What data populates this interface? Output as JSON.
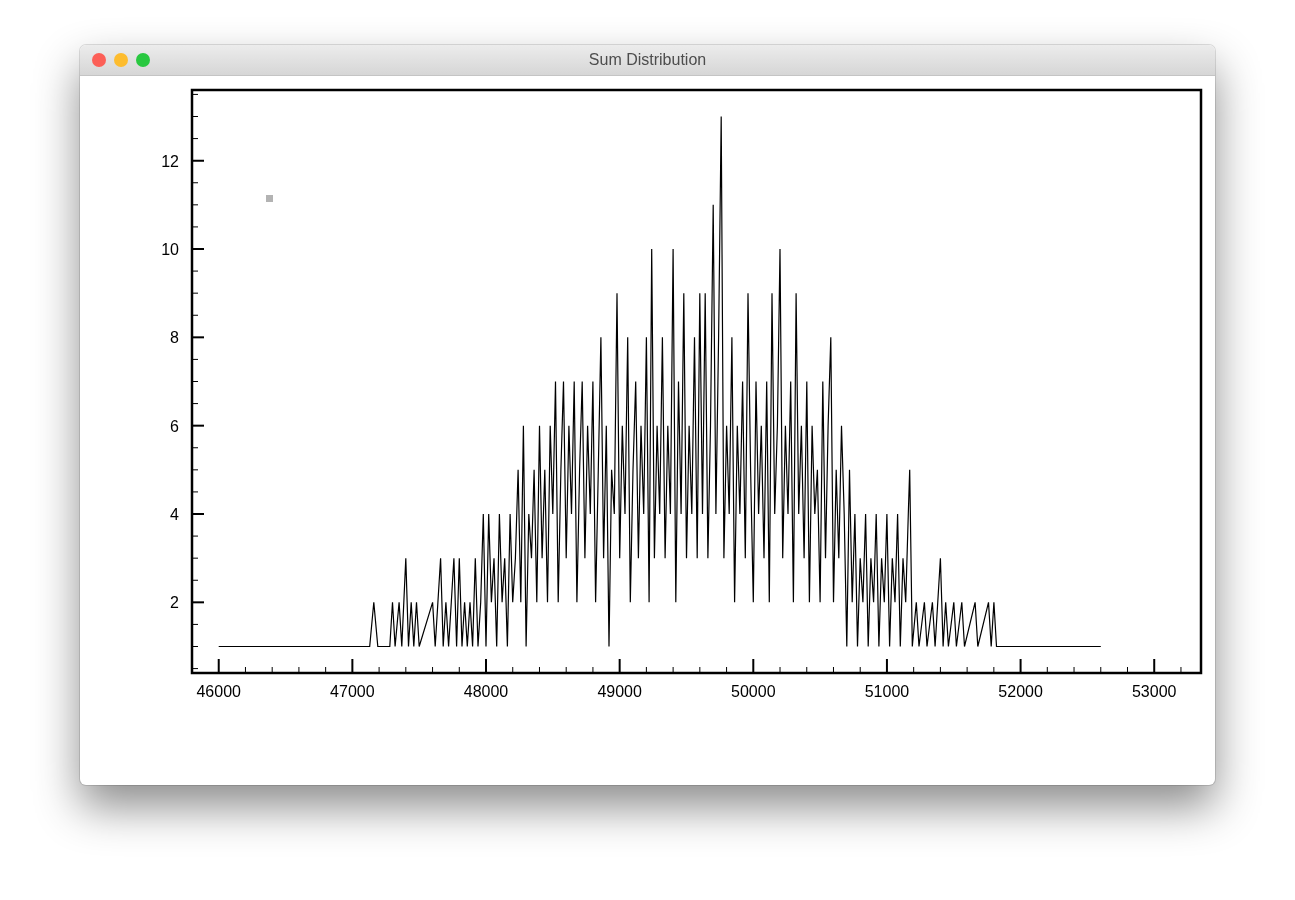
{
  "window": {
    "title": "Sum Distribution"
  },
  "chart": {
    "chart_data": {
      "type": "line",
      "xlim": [
        45800,
        53350
      ],
      "ylim": [
        0.4,
        13.6
      ],
      "xticks": [
        46000,
        47000,
        48000,
        49000,
        50000,
        51000,
        52000,
        53000
      ],
      "yticks": [
        2,
        4,
        6,
        8,
        10,
        12
      ],
      "x": [
        46000,
        47130,
        47160,
        47190,
        47280,
        47300,
        47320,
        47350,
        47370,
        47400,
        47420,
        47440,
        47460,
        47480,
        47500,
        47600,
        47620,
        47640,
        47660,
        47680,
        47700,
        47720,
        47740,
        47760,
        47780,
        47800,
        47820,
        47840,
        47860,
        47880,
        47900,
        47920,
        47940,
        47960,
        47980,
        48000,
        48020,
        48040,
        48060,
        48080,
        48100,
        48120,
        48140,
        48160,
        48180,
        48200,
        48220,
        48240,
        48260,
        48280,
        48300,
        48320,
        48340,
        48360,
        48380,
        48400,
        48420,
        48440,
        48460,
        48480,
        48500,
        48520,
        48540,
        48560,
        48580,
        48600,
        48620,
        48640,
        48660,
        48680,
        48700,
        48720,
        48740,
        48760,
        48780,
        48800,
        48820,
        48840,
        48860,
        48880,
        48900,
        48920,
        48940,
        48960,
        48980,
        49000,
        49020,
        49040,
        49060,
        49080,
        49100,
        49120,
        49140,
        49160,
        49180,
        49200,
        49220,
        49240,
        49260,
        49280,
        49300,
        49320,
        49340,
        49360,
        49380,
        49400,
        49420,
        49440,
        49460,
        49480,
        49500,
        49520,
        49540,
        49560,
        49580,
        49600,
        49620,
        49640,
        49660,
        49680,
        49700,
        49720,
        49740,
        49760,
        49780,
        49800,
        49820,
        49840,
        49860,
        49880,
        49900,
        49920,
        49940,
        49960,
        49980,
        50000,
        50020,
        50040,
        50060,
        50080,
        50100,
        50120,
        50140,
        50160,
        50180,
        50200,
        50220,
        50240,
        50260,
        50280,
        50300,
        50320,
        50340,
        50360,
        50380,
        50400,
        50420,
        50440,
        50460,
        50480,
        50500,
        50520,
        50540,
        50560,
        50580,
        50600,
        50620,
        50640,
        50660,
        50680,
        50700,
        50720,
        50740,
        50760,
        50780,
        50800,
        50820,
        50840,
        50860,
        50880,
        50900,
        50920,
        50940,
        50960,
        50980,
        51000,
        51020,
        51040,
        51060,
        51080,
        51100,
        51120,
        51140,
        51160,
        51170,
        51190,
        51220,
        51240,
        51280,
        51300,
        51340,
        51360,
        51400,
        51420,
        51440,
        51460,
        51500,
        51520,
        51560,
        51580,
        51660,
        51680,
        51760,
        51780,
        51800,
        51820,
        52600
      ],
      "series": [
        {
          "values": [
            1,
            1,
            2,
            1,
            1,
            2,
            1,
            2,
            1,
            3,
            1,
            2,
            1,
            2,
            1,
            2,
            1,
            2,
            3,
            1,
            2,
            1,
            2,
            3,
            1,
            3,
            1,
            2,
            1,
            2,
            1,
            3,
            1,
            2,
            4,
            1,
            4,
            2,
            3,
            1,
            4,
            2,
            3,
            1,
            4,
            2,
            3,
            5,
            2,
            6,
            1,
            4,
            3,
            5,
            2,
            6,
            3,
            5,
            2,
            6,
            4,
            7,
            2,
            5,
            7,
            3,
            6,
            4,
            7,
            2,
            5,
            7,
            3,
            6,
            4,
            7,
            2,
            5,
            8,
            3,
            6,
            1,
            5,
            4,
            9,
            3,
            6,
            4,
            8,
            2,
            5,
            7,
            3,
            6,
            4,
            8,
            2,
            10,
            3,
            6,
            4,
            8,
            3,
            6,
            4,
            10,
            2,
            7,
            4,
            9,
            3,
            6,
            4,
            8,
            3,
            9,
            4,
            9,
            3,
            6,
            11,
            4,
            8,
            13,
            3,
            6,
            4,
            8,
            2,
            6,
            4,
            7,
            3,
            9,
            5,
            2,
            7,
            4,
            6,
            3,
            7,
            2,
            9,
            4,
            6,
            10,
            3,
            6,
            4,
            7,
            2,
            9,
            4,
            6,
            3,
            7,
            2,
            6,
            4,
            5,
            2,
            7,
            3,
            6,
            8,
            2,
            5,
            3,
            6,
            4,
            1,
            5,
            2,
            4,
            1,
            3,
            2,
            4,
            1,
            3,
            2,
            4,
            1,
            3,
            2,
            4,
            1,
            3,
            2,
            4,
            1,
            3,
            2,
            4,
            5,
            1,
            2,
            1,
            2,
            1,
            2,
            1,
            3,
            1,
            2,
            1,
            2,
            1,
            2,
            1,
            2,
            1,
            2,
            1,
            2,
            1,
            1
          ]
        }
      ]
    }
  }
}
